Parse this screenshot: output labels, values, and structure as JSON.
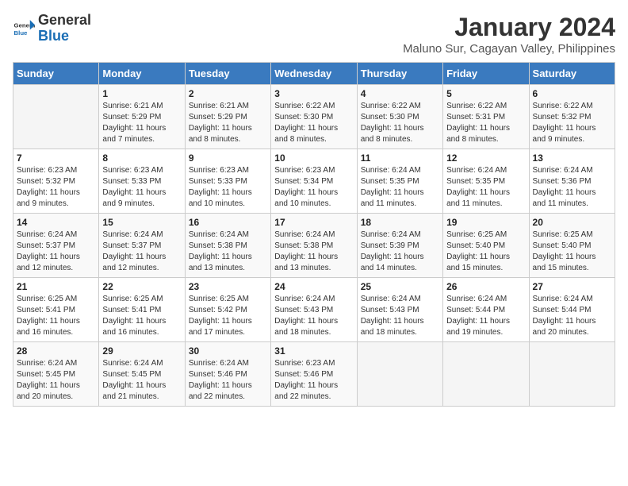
{
  "logo": {
    "line1": "General",
    "line2": "Blue"
  },
  "title": "January 2024",
  "subtitle": "Maluno Sur, Cagayan Valley, Philippines",
  "days_header": [
    "Sunday",
    "Monday",
    "Tuesday",
    "Wednesday",
    "Thursday",
    "Friday",
    "Saturday"
  ],
  "weeks": [
    [
      {
        "num": "",
        "info": ""
      },
      {
        "num": "1",
        "info": "Sunrise: 6:21 AM\nSunset: 5:29 PM\nDaylight: 11 hours\nand 7 minutes."
      },
      {
        "num": "2",
        "info": "Sunrise: 6:21 AM\nSunset: 5:29 PM\nDaylight: 11 hours\nand 8 minutes."
      },
      {
        "num": "3",
        "info": "Sunrise: 6:22 AM\nSunset: 5:30 PM\nDaylight: 11 hours\nand 8 minutes."
      },
      {
        "num": "4",
        "info": "Sunrise: 6:22 AM\nSunset: 5:30 PM\nDaylight: 11 hours\nand 8 minutes."
      },
      {
        "num": "5",
        "info": "Sunrise: 6:22 AM\nSunset: 5:31 PM\nDaylight: 11 hours\nand 8 minutes."
      },
      {
        "num": "6",
        "info": "Sunrise: 6:22 AM\nSunset: 5:32 PM\nDaylight: 11 hours\nand 9 minutes."
      }
    ],
    [
      {
        "num": "7",
        "info": "Sunrise: 6:23 AM\nSunset: 5:32 PM\nDaylight: 11 hours\nand 9 minutes."
      },
      {
        "num": "8",
        "info": "Sunrise: 6:23 AM\nSunset: 5:33 PM\nDaylight: 11 hours\nand 9 minutes."
      },
      {
        "num": "9",
        "info": "Sunrise: 6:23 AM\nSunset: 5:33 PM\nDaylight: 11 hours\nand 10 minutes."
      },
      {
        "num": "10",
        "info": "Sunrise: 6:23 AM\nSunset: 5:34 PM\nDaylight: 11 hours\nand 10 minutes."
      },
      {
        "num": "11",
        "info": "Sunrise: 6:24 AM\nSunset: 5:35 PM\nDaylight: 11 hours\nand 11 minutes."
      },
      {
        "num": "12",
        "info": "Sunrise: 6:24 AM\nSunset: 5:35 PM\nDaylight: 11 hours\nand 11 minutes."
      },
      {
        "num": "13",
        "info": "Sunrise: 6:24 AM\nSunset: 5:36 PM\nDaylight: 11 hours\nand 11 minutes."
      }
    ],
    [
      {
        "num": "14",
        "info": "Sunrise: 6:24 AM\nSunset: 5:37 PM\nDaylight: 11 hours\nand 12 minutes."
      },
      {
        "num": "15",
        "info": "Sunrise: 6:24 AM\nSunset: 5:37 PM\nDaylight: 11 hours\nand 12 minutes."
      },
      {
        "num": "16",
        "info": "Sunrise: 6:24 AM\nSunset: 5:38 PM\nDaylight: 11 hours\nand 13 minutes."
      },
      {
        "num": "17",
        "info": "Sunrise: 6:24 AM\nSunset: 5:38 PM\nDaylight: 11 hours\nand 13 minutes."
      },
      {
        "num": "18",
        "info": "Sunrise: 6:24 AM\nSunset: 5:39 PM\nDaylight: 11 hours\nand 14 minutes."
      },
      {
        "num": "19",
        "info": "Sunrise: 6:25 AM\nSunset: 5:40 PM\nDaylight: 11 hours\nand 15 minutes."
      },
      {
        "num": "20",
        "info": "Sunrise: 6:25 AM\nSunset: 5:40 PM\nDaylight: 11 hours\nand 15 minutes."
      }
    ],
    [
      {
        "num": "21",
        "info": "Sunrise: 6:25 AM\nSunset: 5:41 PM\nDaylight: 11 hours\nand 16 minutes."
      },
      {
        "num": "22",
        "info": "Sunrise: 6:25 AM\nSunset: 5:41 PM\nDaylight: 11 hours\nand 16 minutes."
      },
      {
        "num": "23",
        "info": "Sunrise: 6:25 AM\nSunset: 5:42 PM\nDaylight: 11 hours\nand 17 minutes."
      },
      {
        "num": "24",
        "info": "Sunrise: 6:24 AM\nSunset: 5:43 PM\nDaylight: 11 hours\nand 18 minutes."
      },
      {
        "num": "25",
        "info": "Sunrise: 6:24 AM\nSunset: 5:43 PM\nDaylight: 11 hours\nand 18 minutes."
      },
      {
        "num": "26",
        "info": "Sunrise: 6:24 AM\nSunset: 5:44 PM\nDaylight: 11 hours\nand 19 minutes."
      },
      {
        "num": "27",
        "info": "Sunrise: 6:24 AM\nSunset: 5:44 PM\nDaylight: 11 hours\nand 20 minutes."
      }
    ],
    [
      {
        "num": "28",
        "info": "Sunrise: 6:24 AM\nSunset: 5:45 PM\nDaylight: 11 hours\nand 20 minutes."
      },
      {
        "num": "29",
        "info": "Sunrise: 6:24 AM\nSunset: 5:45 PM\nDaylight: 11 hours\nand 21 minutes."
      },
      {
        "num": "30",
        "info": "Sunrise: 6:24 AM\nSunset: 5:46 PM\nDaylight: 11 hours\nand 22 minutes."
      },
      {
        "num": "31",
        "info": "Sunrise: 6:23 AM\nSunset: 5:46 PM\nDaylight: 11 hours\nand 22 minutes."
      },
      {
        "num": "",
        "info": ""
      },
      {
        "num": "",
        "info": ""
      },
      {
        "num": "",
        "info": ""
      }
    ]
  ]
}
